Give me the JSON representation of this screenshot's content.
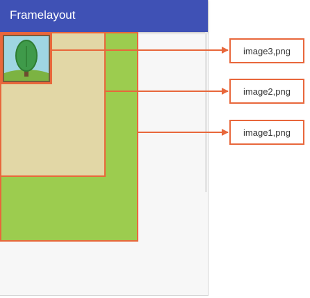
{
  "app": {
    "title": "Framelayout"
  },
  "labels": {
    "image3": "image3,png",
    "image2": "image2,png",
    "image1": "image1,png"
  },
  "colors": {
    "appbar": "#3f51b5",
    "accent": "#e8673b",
    "image1_fill": "#9ccc4f",
    "image2_fill": "#e2d7a6"
  },
  "icons": {
    "image3": "tree-icon"
  }
}
